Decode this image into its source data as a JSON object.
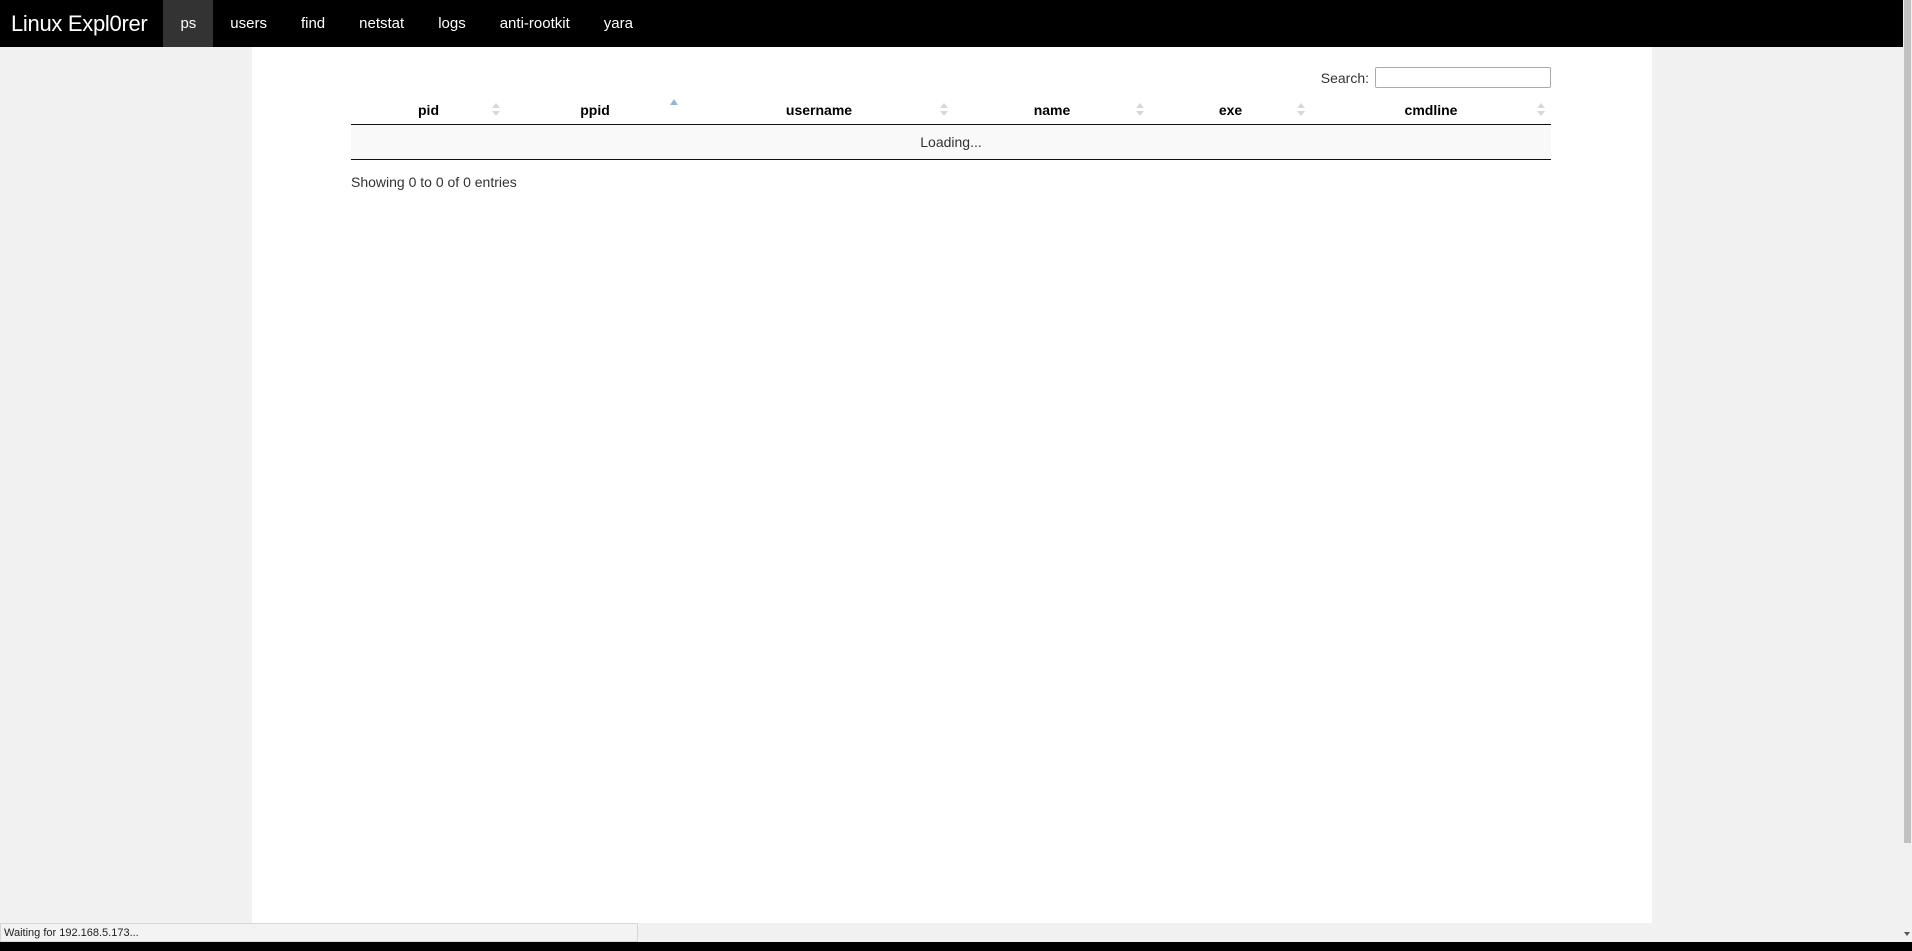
{
  "navbar": {
    "brand": "Linux Expl0rer",
    "items": [
      {
        "label": "ps",
        "active": true
      },
      {
        "label": "users"
      },
      {
        "label": "find"
      },
      {
        "label": "netstat"
      },
      {
        "label": "logs"
      },
      {
        "label": "anti-rootkit"
      },
      {
        "label": "yara"
      }
    ]
  },
  "search": {
    "label": "Search:",
    "value": ""
  },
  "table": {
    "columns": [
      "pid",
      "ppid",
      "username",
      "name",
      "exe",
      "cmdline"
    ],
    "sorted_column": "ppid",
    "sort_direction": "asc",
    "loading_text": "Loading..."
  },
  "info_text": "Showing 0 to 0 of 0 entries",
  "status_text": "Waiting for 192.168.5.173..."
}
